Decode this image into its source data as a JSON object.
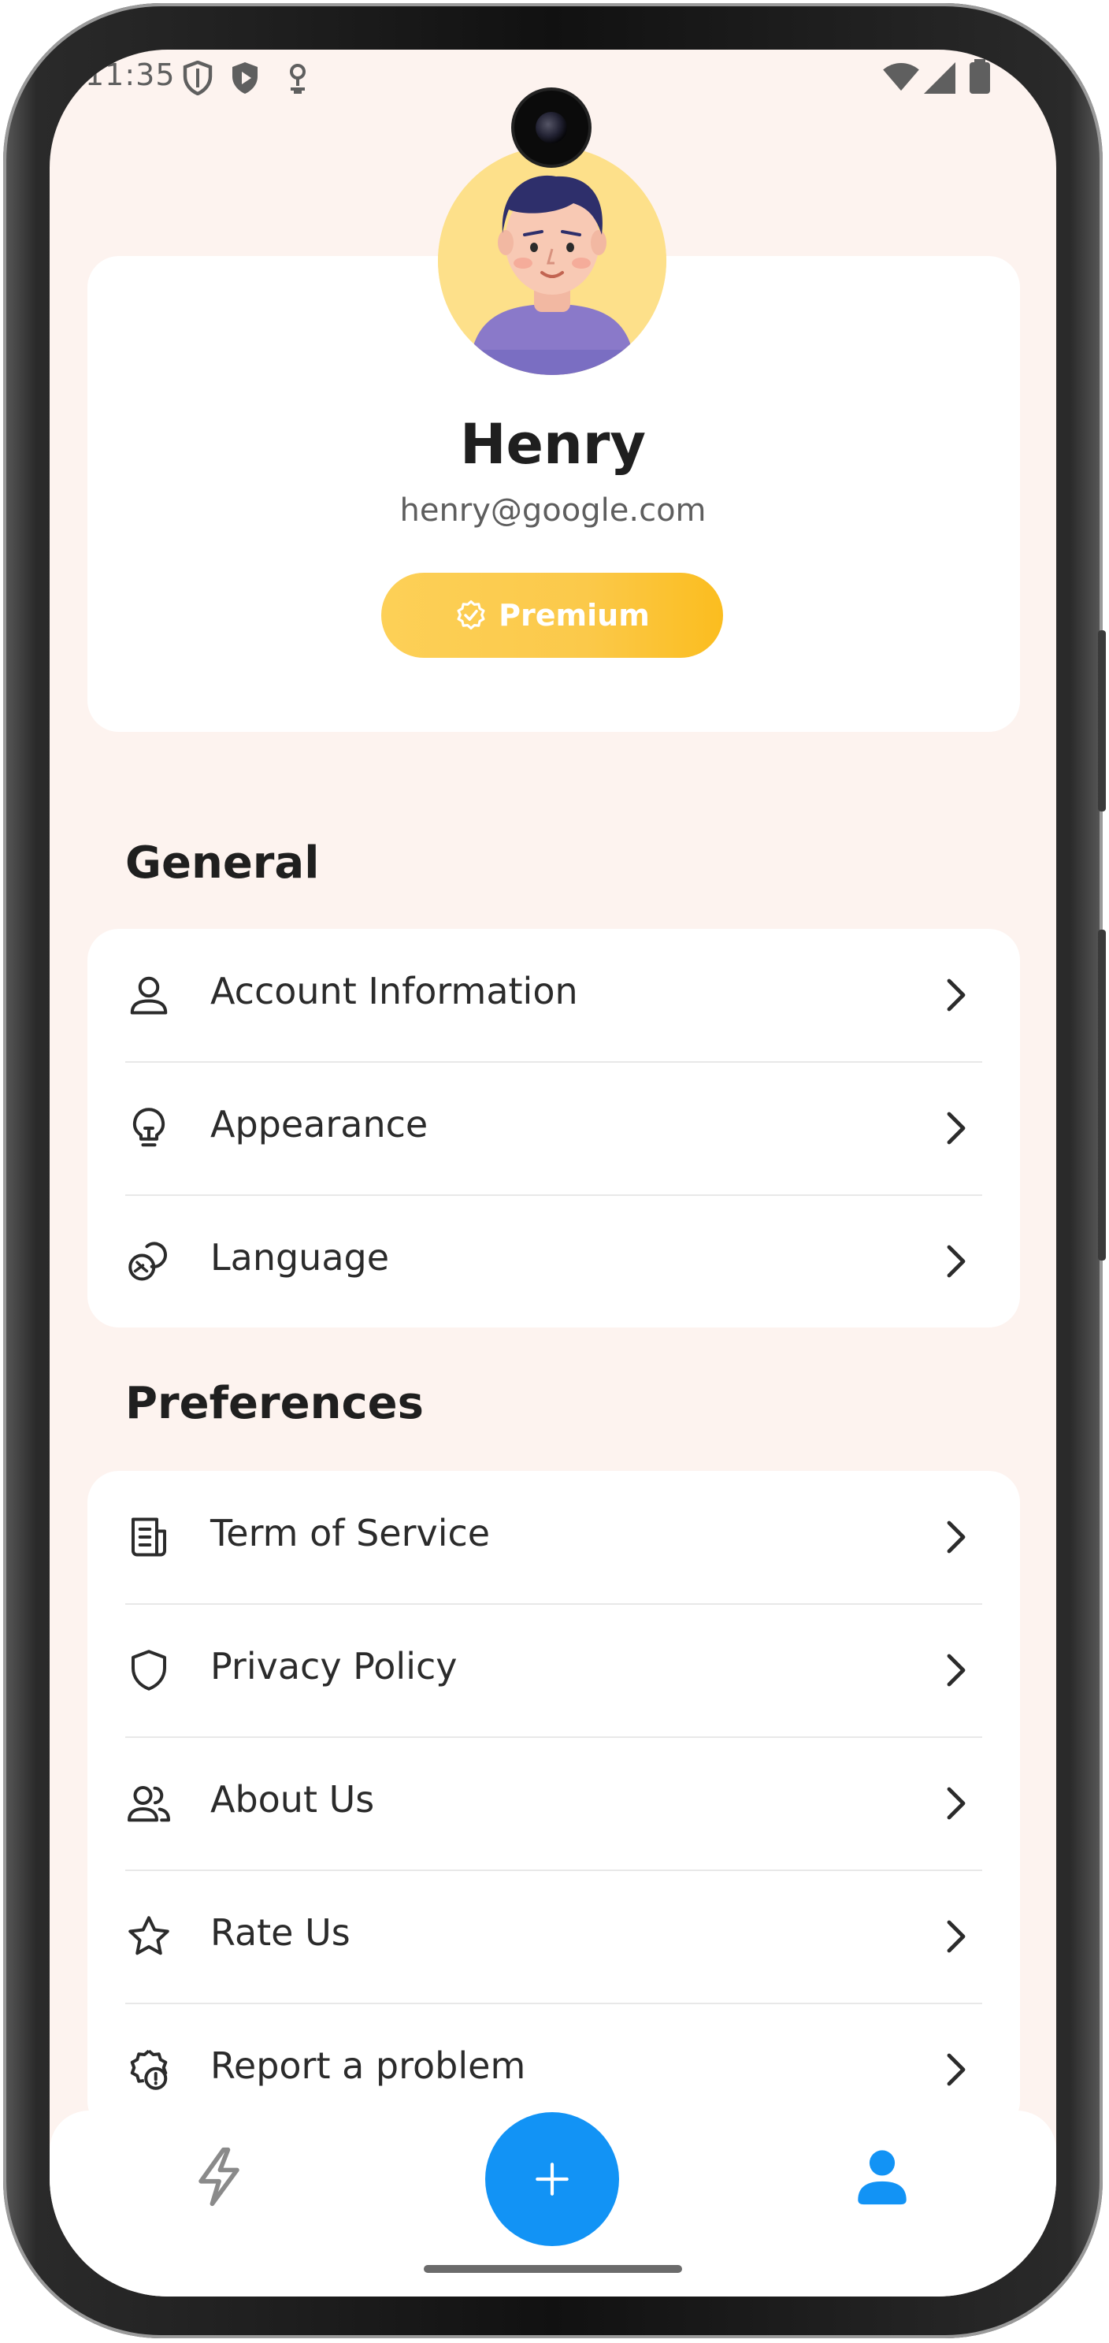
{
  "status_bar": {
    "time": "11:35",
    "icons": [
      "shield-icon",
      "play-protect-icon",
      "location-icon",
      "wifi-icon",
      "signal-icon",
      "battery-icon"
    ]
  },
  "profile": {
    "name": "Henry",
    "email": "henry@google.com",
    "badge_label": "Premium",
    "badge_icon": "verified-icon",
    "avatar": "avatar-illustration"
  },
  "general": {
    "title": "General",
    "items": [
      {
        "label": "Account Information",
        "icon": "user-icon"
      },
      {
        "label": "Appearance",
        "icon": "lightbulb-icon"
      },
      {
        "label": "Language",
        "icon": "language-icon"
      }
    ]
  },
  "preferences": {
    "title": "Preferences",
    "items": [
      {
        "label": "Term of Service",
        "icon": "document-icon"
      },
      {
        "label": "Privacy Policy",
        "icon": "shield-icon"
      },
      {
        "label": "About Us",
        "icon": "users-icon"
      },
      {
        "label": "Rate Us",
        "icon": "star-icon"
      },
      {
        "label": "Report a problem",
        "icon": "report-icon"
      }
    ]
  },
  "bottom_nav": {
    "items": [
      "lightning-icon",
      "add-icon",
      "profile-icon"
    ],
    "active": "profile-icon"
  },
  "colors": {
    "background": "#fdf3ef",
    "accent_blue": "#1293f5",
    "premium_gold": "#fbc94a",
    "text_dark": "#1f1f1f"
  }
}
